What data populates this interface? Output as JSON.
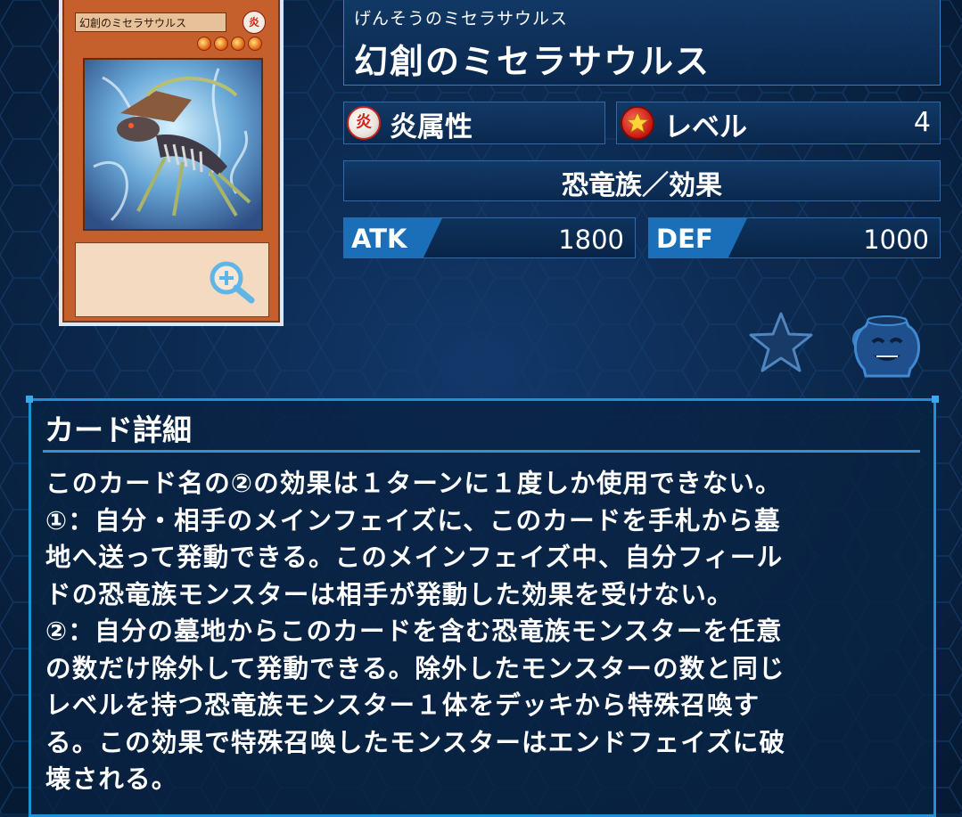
{
  "card": {
    "furigana": "げんそうのミセラサウルス",
    "name": "幻創のミセラサウルス",
    "thumb_name": "幻創のミセラサウルス",
    "thumb_attribute_glyph": "炎",
    "level_stars": 4
  },
  "attribute": {
    "glyph": "炎",
    "label": "炎属性"
  },
  "level": {
    "label": "レベル",
    "value": "4"
  },
  "type_line": "恐竜族／効果",
  "stats": {
    "atk_label": "ATK",
    "atk_value": "1800",
    "def_label": "DEF",
    "def_value": "1000"
  },
  "details": {
    "heading": "カード詳細",
    "text": "このカード名の②の効果は１ターンに１度しか使用できない。\n①：自分・相手のメインフェイズに、このカードを手札から墓\n地へ送って発動できる。このメインフェイズ中、自分フィール\nドの恐竜族モンスターは相手が発動した効果を受けない。\n②：自分の墓地からこのカードを含む恐竜族モンスターを任意\nの数だけ除外して発動できる。除外したモンスターの数と同じ\nレベルを持つ恐竜族モンスター１体をデッキから特殊召喚す\nる。この効果で特殊召喚したモンスターはエンドフェイズに破\n壊される。"
  },
  "icons": {
    "zoom": "zoom-in-icon",
    "favorite": "star-icon",
    "pot": "pot-of-greed-icon"
  },
  "colors": {
    "background": "#0b2646",
    "accent": "#1f8fd8",
    "fire": "#d0231a"
  }
}
